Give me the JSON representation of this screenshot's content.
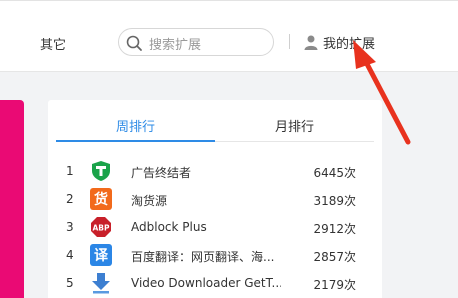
{
  "header": {
    "nav_other": "其它",
    "search_placeholder": "搜索扩展",
    "my_extensions": "我的扩展"
  },
  "ranking": {
    "tabs": [
      {
        "label": "周排行",
        "active": true
      },
      {
        "label": "月排行",
        "active": false
      }
    ],
    "items": [
      {
        "rank": "1",
        "name": "广告终结者",
        "count": "6445次",
        "icon": "shield-t-icon"
      },
      {
        "rank": "2",
        "name": "淘货源",
        "count": "3189次",
        "icon": "huo-badge-icon"
      },
      {
        "rank": "3",
        "name": "Adblock Plus",
        "count": "2912次",
        "icon": "abp-stop-sign-icon"
      },
      {
        "rank": "4",
        "name": "百度翻译：网页翻译、海...",
        "count": "2857次",
        "icon": "yi-translate-icon"
      },
      {
        "rank": "5",
        "name": "Video Downloader GetT...",
        "count": "2179次",
        "icon": "download-arrow-icon"
      }
    ]
  },
  "colors": {
    "accent": "#2e8be6",
    "pink_panel": "#ea0a74",
    "annotation_arrow": "#e8321e"
  }
}
